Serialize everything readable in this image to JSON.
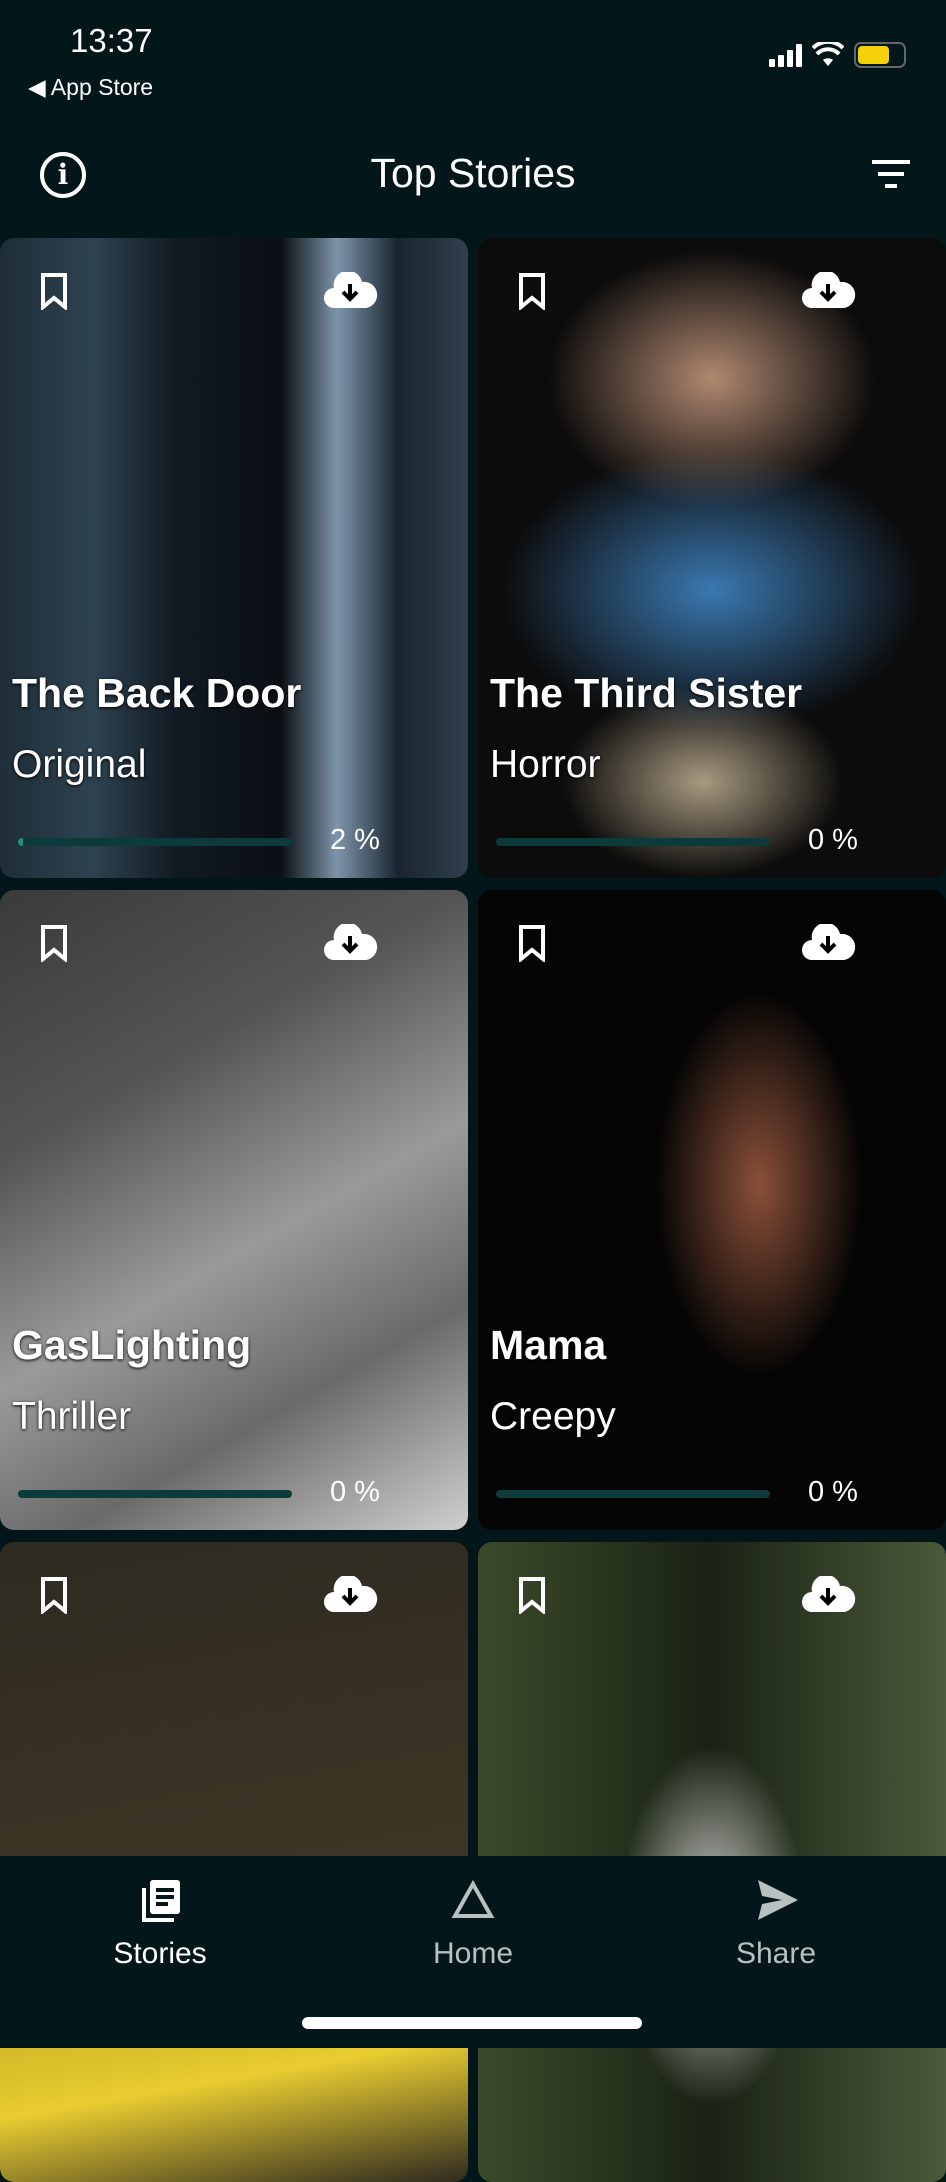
{
  "status_bar": {
    "time": "13:37",
    "back_label": "◀ App Store",
    "battery_color": "#f5d10a"
  },
  "header": {
    "title": "Top Stories",
    "left_icon": "info-icon",
    "right_icon": "filter-icon"
  },
  "stories": [
    {
      "title": "The Back Door",
      "genre": "Original",
      "progress_percent": 2,
      "progress_label": "2 %"
    },
    {
      "title": "The Third Sister",
      "genre": "Horror",
      "progress_percent": 0,
      "progress_label": "0 %"
    },
    {
      "title": "GasLighting",
      "genre": "Thriller",
      "progress_percent": 0,
      "progress_label": "0 %"
    },
    {
      "title": "Mama",
      "genre": "Creepy",
      "progress_percent": 0,
      "progress_label": "0 %"
    },
    {
      "title": "",
      "genre": "",
      "progress_label": ""
    },
    {
      "title": "",
      "genre": "",
      "progress_label": ""
    }
  ],
  "tabs": [
    {
      "label": "Stories",
      "icon": "stories-icon",
      "active": true
    },
    {
      "label": "Home",
      "icon": "triangle-icon",
      "active": false
    },
    {
      "label": "Share",
      "icon": "send-icon",
      "active": false
    }
  ],
  "colors": {
    "background": "#03161a",
    "progress_fill": "#2a8a7a",
    "progress_track": "#0d3a3a"
  }
}
